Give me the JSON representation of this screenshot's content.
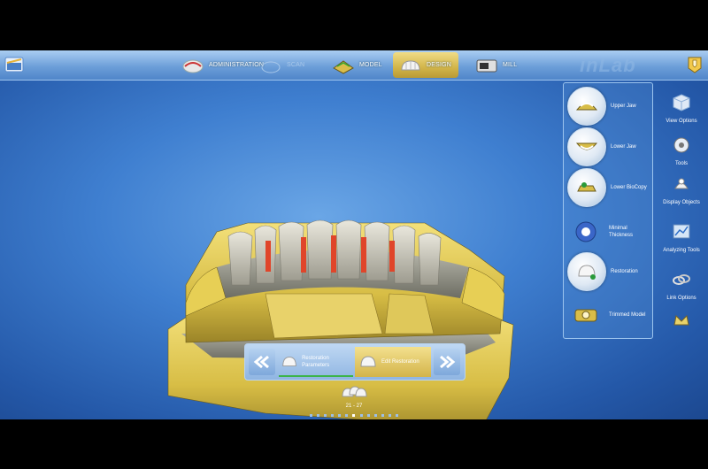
{
  "app": {
    "brand": "inLab"
  },
  "steps": [
    {
      "label": "ADMINISTRATION",
      "state": "normal"
    },
    {
      "label": "SCAN",
      "state": "disabled"
    },
    {
      "label": "MODEL",
      "state": "normal"
    },
    {
      "label": "DESIGN",
      "state": "active"
    },
    {
      "label": "MILL",
      "state": "normal"
    }
  ],
  "right_panel": {
    "items": [
      {
        "label": "Upper Jaw",
        "icon": "upper-jaw-icon"
      },
      {
        "label": "Lower Jaw",
        "icon": "lower-jaw-icon"
      },
      {
        "label": "Lower BioCopy",
        "icon": "lower-biocopy-icon"
      },
      {
        "label": "Minimal Thickness",
        "icon": "minimal-thickness-icon"
      },
      {
        "label": "Restoration",
        "icon": "restoration-icon"
      },
      {
        "label": "Trimmed Model",
        "icon": "trimmed-model-icon"
      }
    ]
  },
  "tools": [
    {
      "label": "View Options",
      "icon": "cube-icon"
    },
    {
      "label": "Tools",
      "icon": "tools-icon"
    },
    {
      "label": "Display Objects",
      "icon": "display-objects-icon"
    },
    {
      "label": "Analyzing Tools",
      "icon": "analyzing-tools-icon"
    },
    {
      "label": "Link Options",
      "icon": "link-icon"
    }
  ],
  "wizard": {
    "steps": [
      {
        "label": "Restoration Parameters",
        "state": "done"
      },
      {
        "label": "Edit Restoration",
        "state": "active"
      }
    ],
    "prev_icon": "double-chevron-left-icon",
    "next_icon": "double-chevron-right-icon"
  },
  "restoration_range": "21 - 27",
  "colors": {
    "accent": "#d6b94e",
    "background": "#3f7fd0",
    "model": "#d9c04a",
    "teeth": "#c9c7b8"
  }
}
